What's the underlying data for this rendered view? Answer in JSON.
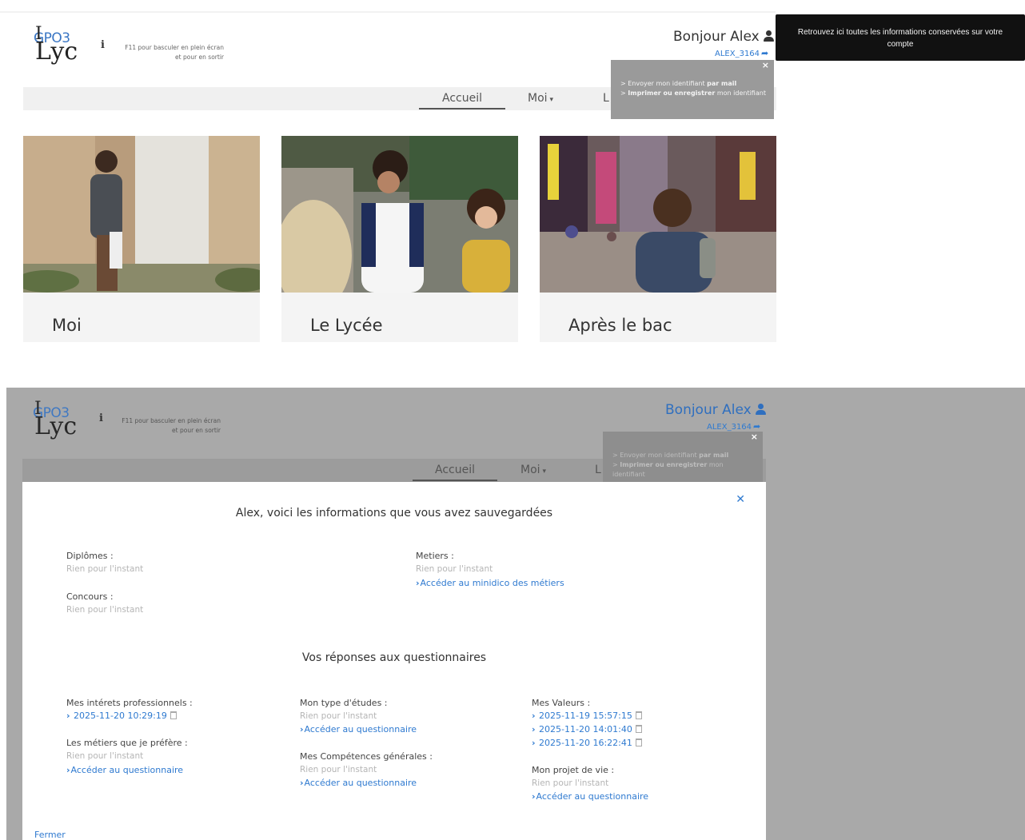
{
  "header": {
    "logo_line1": "GPO3",
    "logo_line2": "Lyc",
    "hint_line1": "F11 pour basculer en plein écran",
    "hint_line2": "et pour en sortir",
    "greeting": "Bonjour Alex",
    "user_id": "ALEX_3164"
  },
  "nav": {
    "items": [
      {
        "label": "Accueil"
      },
      {
        "label": "Moi"
      },
      {
        "label": "L"
      }
    ]
  },
  "id_popover": {
    "line1_prefix": "> Envoyer mon identifiant ",
    "line1_bold": "par mail",
    "line2_prefix": "> ",
    "line2_bold": "Imprimer ou enregistrer",
    "line2_suffix": " mon identifiant"
  },
  "tooltip": {
    "text": "Retrouvez ici toutes les informations conservées sur votre compte"
  },
  "cards": [
    {
      "title": "Moi"
    },
    {
      "title": "Le Lycée"
    },
    {
      "title": "Après le bac"
    }
  ],
  "modal": {
    "title": "Alex, voici les informations que vous avez sauvegardées",
    "empty_text": "Rien pour l'instant",
    "diplomes_label": "Diplômes :",
    "concours_label": "Concours :",
    "metiers_label": "Metiers :",
    "metiers_link": "Accéder au minidico des métiers",
    "questionnaires_title": "Vos réponses aux questionnaires",
    "interets_label": "Mes intérets professionnels :",
    "interets_dates": [
      "2025-11-20 10:29:19"
    ],
    "metiers_prefere_label": "Les métiers que je préfère :",
    "type_etudes_label": "Mon type d'études :",
    "competences_label": "Mes Compétences générales :",
    "valeurs_label": "Mes Valeurs :",
    "valeurs_dates": [
      "2025-11-19 15:57:15",
      "2025-11-20 14:01:40",
      "2025-11-20 16:22:41"
    ],
    "projet_label": "Mon projet de vie :",
    "questionnaire_link": "Accéder au questionnaire",
    "close_button": "Fermer"
  }
}
